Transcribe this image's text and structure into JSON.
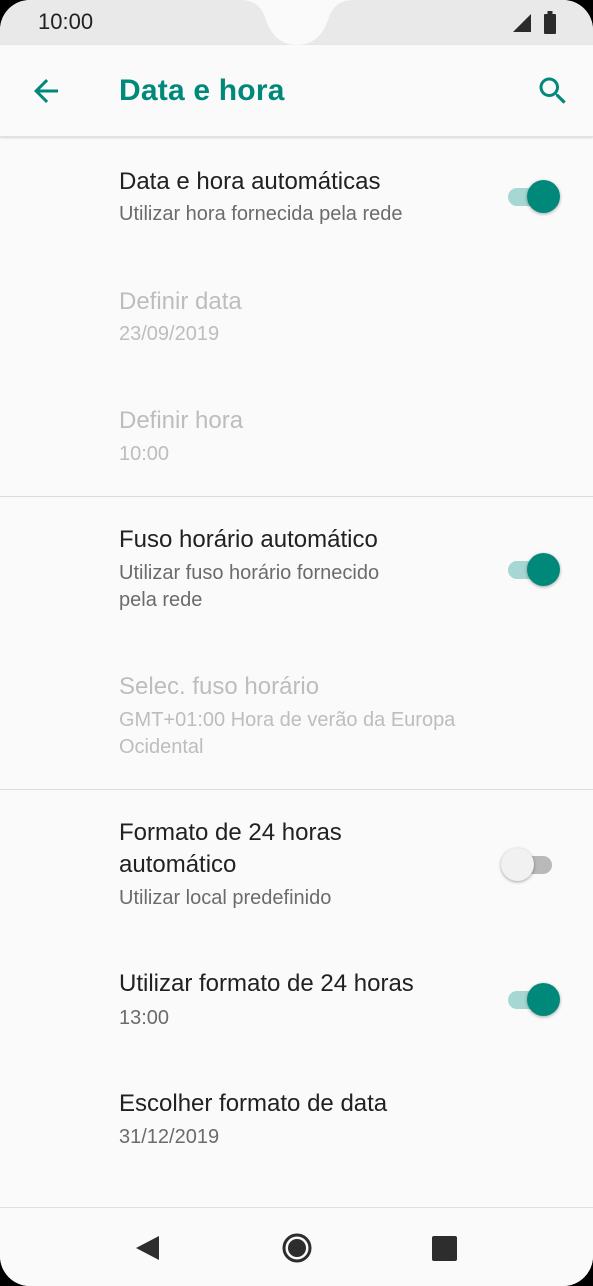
{
  "status_bar": {
    "time": "10:00",
    "icons": [
      "signal-icon",
      "battery-icon"
    ]
  },
  "app_bar": {
    "title": "Data e hora",
    "back_icon": "arrow-left-icon",
    "search_icon": "search-icon"
  },
  "settings": {
    "auto_datetime": {
      "title": "Data e hora automáticas",
      "subtitle": "Utilizar hora fornecida pela rede",
      "enabled": true,
      "toggle_on": true
    },
    "set_date": {
      "title": "Definir data",
      "value": "23/09/2019",
      "enabled": false
    },
    "set_time": {
      "title": "Definir hora",
      "value": "10:00",
      "enabled": false
    },
    "auto_timezone": {
      "title": "Fuso horário automático",
      "subtitle_line1": "Utilizar fuso horário fornecido",
      "subtitle_line2": "pela rede",
      "enabled": true,
      "toggle_on": true
    },
    "select_timezone": {
      "title": "Selec. fuso horário",
      "value_line1": "GMT+01:00 Hora de verão da Europa",
      "value_line2": "Ocidental",
      "enabled": false
    },
    "auto_24h": {
      "title_line1": "Formato de 24 horas",
      "title_line2": "automático",
      "subtitle": "Utilizar local predefinido",
      "enabled": true,
      "toggle_on": false
    },
    "use_24h": {
      "title": "Utilizar formato de 24 horas",
      "value": "13:00",
      "enabled": true,
      "toggle_on": true
    },
    "date_format": {
      "title": "Escolher formato de data",
      "value": "31/12/2019",
      "enabled": true
    }
  },
  "nav_bar": {
    "icons": [
      "back-triangle-icon",
      "home-circle-icon",
      "recents-square-icon"
    ]
  },
  "colors": {
    "accent": "#00897b",
    "accent_track": "#a7d7d2",
    "background": "#fafafa",
    "status_bar": "#e9e9e9",
    "text_primary": "#212121",
    "text_secondary": "#6b6b6b",
    "text_disabled": "#bdbdbd"
  }
}
